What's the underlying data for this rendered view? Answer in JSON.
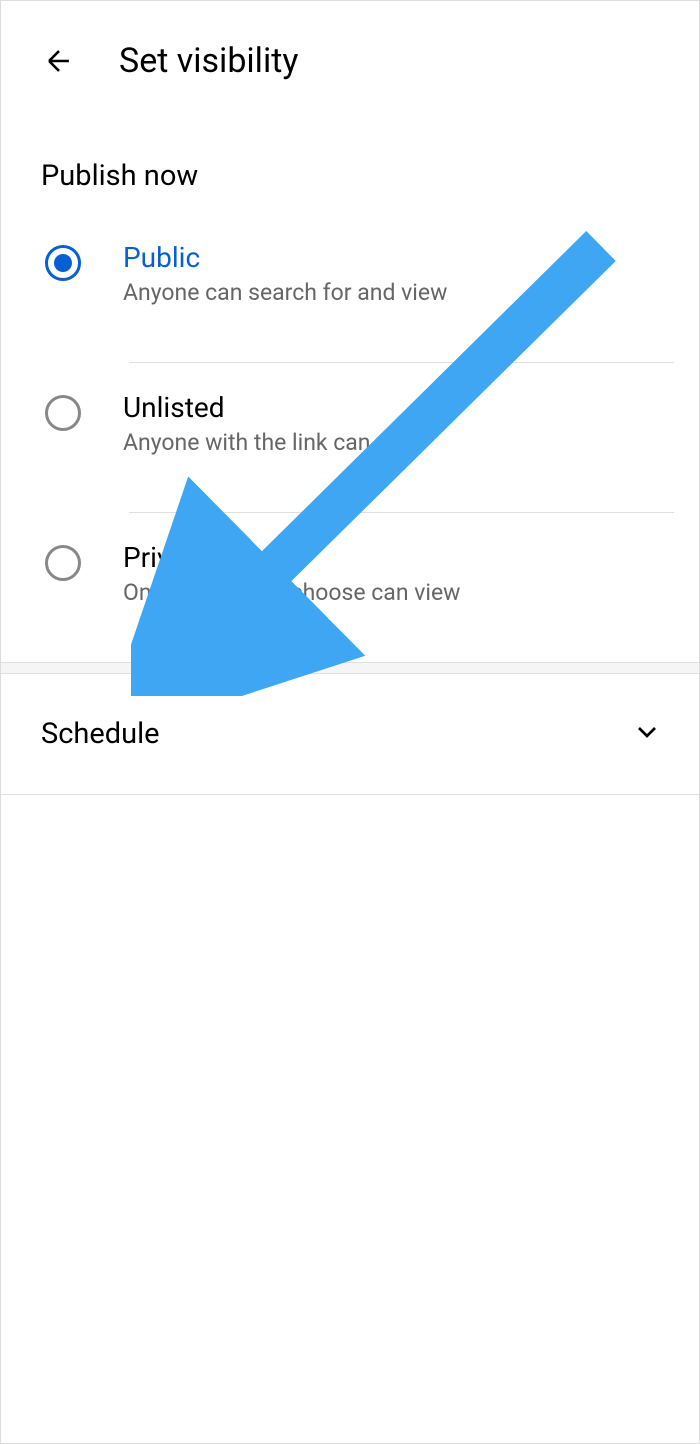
{
  "header": {
    "title": "Set visibility"
  },
  "publish": {
    "section_title": "Publish now",
    "options": [
      {
        "label": "Public",
        "desc": "Anyone can search for and view",
        "selected": true
      },
      {
        "label": "Unlisted",
        "desc": "Anyone with the link can view",
        "selected": false
      },
      {
        "label": "Private",
        "desc": "Only people you choose can view",
        "selected": false
      }
    ]
  },
  "schedule": {
    "label": "Schedule"
  }
}
